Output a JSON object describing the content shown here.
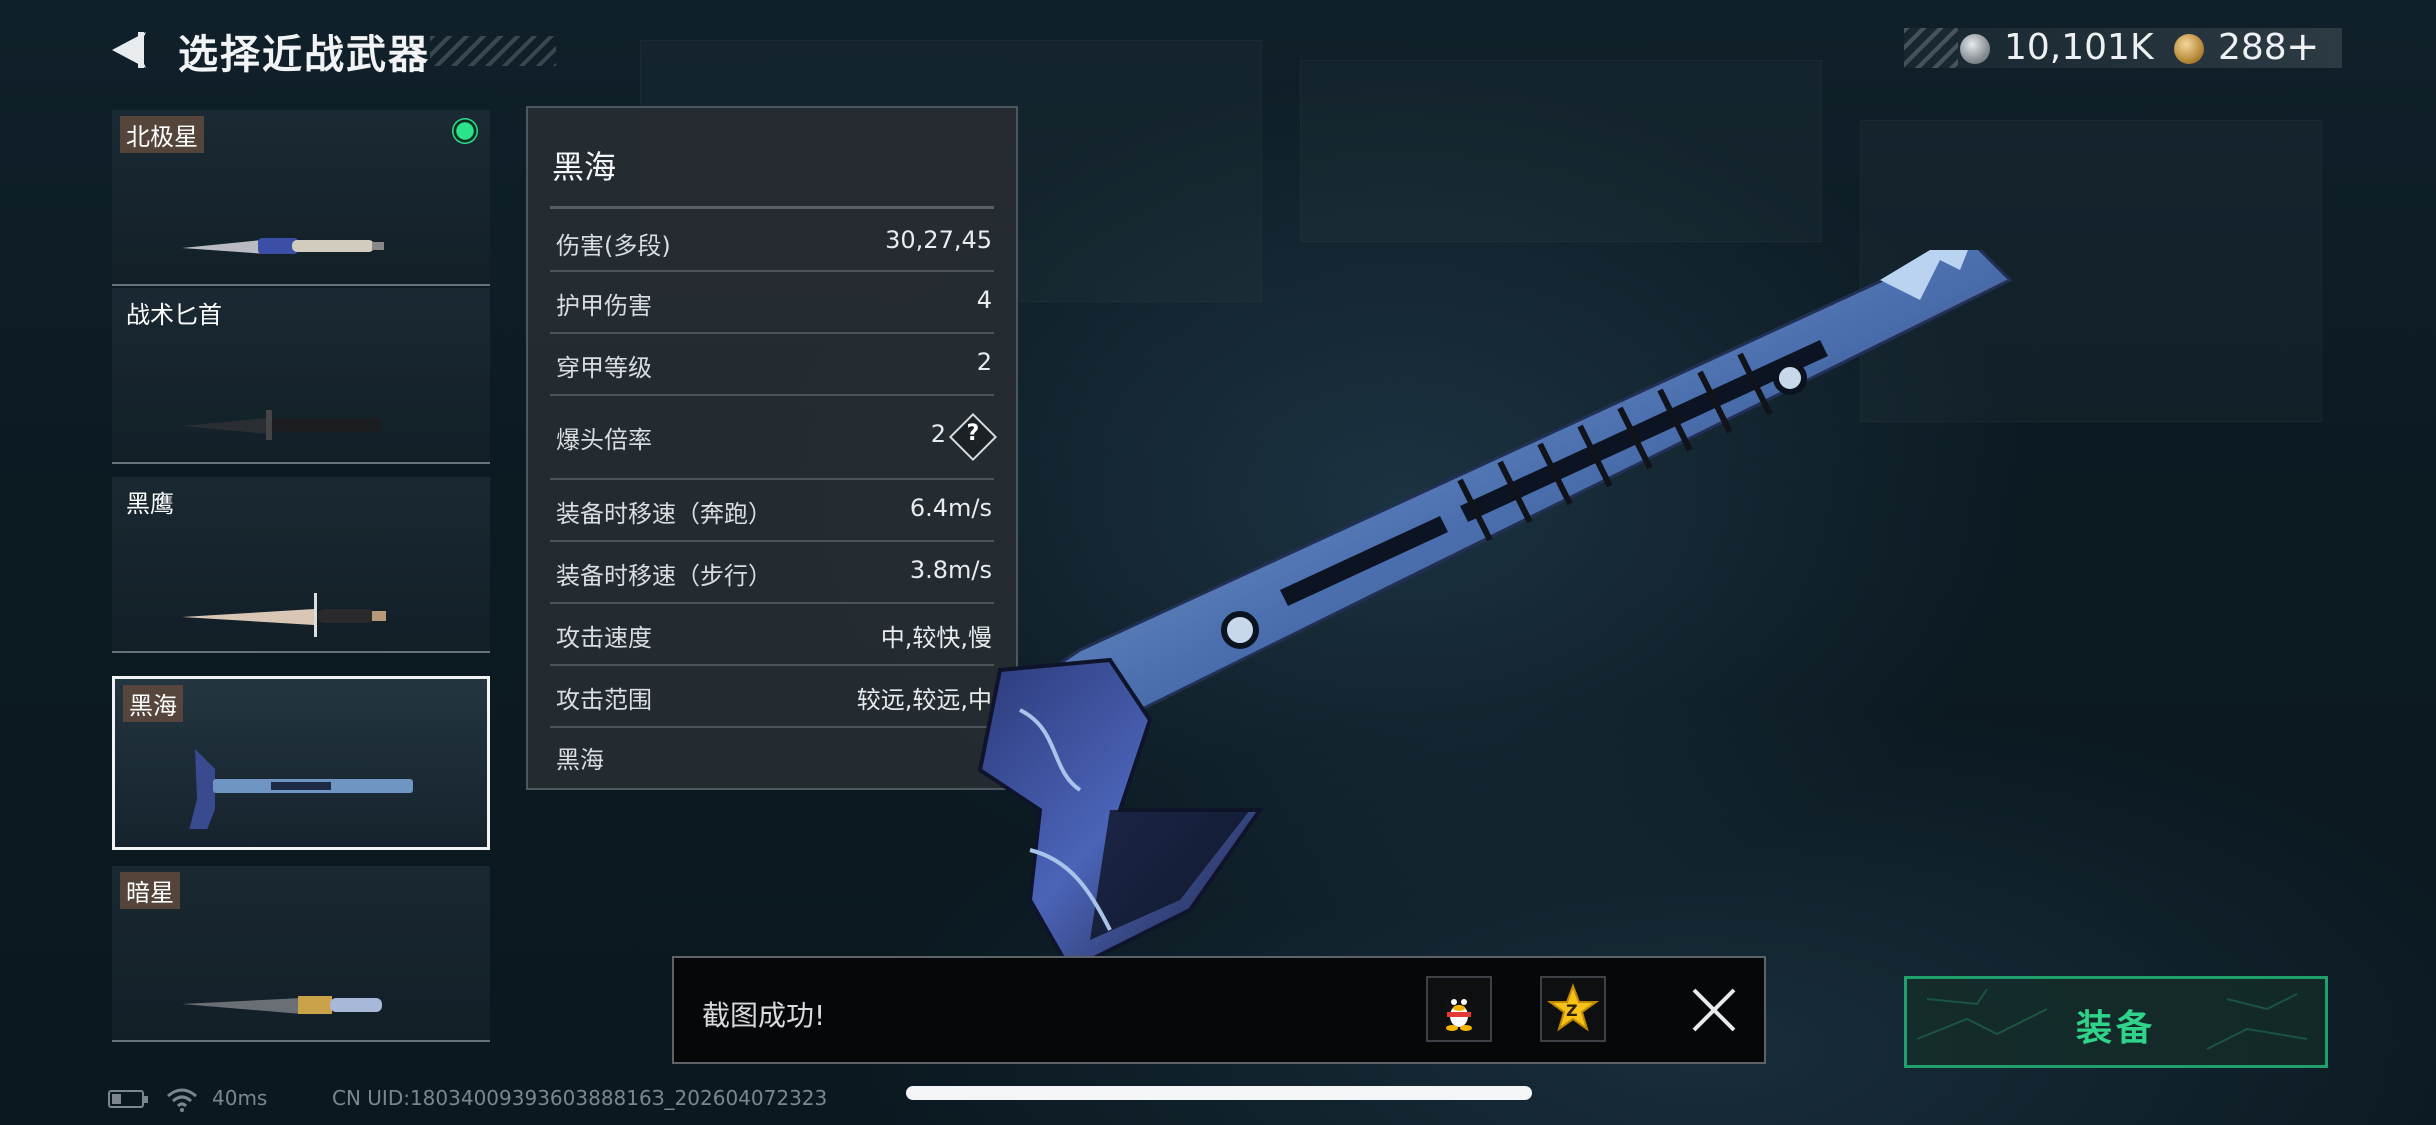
{
  "header": {
    "title": "选择近战武器"
  },
  "currency": {
    "silver": "10,101K",
    "gold": "288",
    "plus": "+"
  },
  "weapons": [
    {
      "name": "北极星",
      "equipped": true,
      "selected": false
    },
    {
      "name": "战术匕首",
      "equipped": false,
      "selected": false
    },
    {
      "name": "黑鹰",
      "equipped": false,
      "selected": false
    },
    {
      "name": "黑海",
      "equipped": false,
      "selected": true
    },
    {
      "name": "暗星",
      "equipped": false,
      "selected": false
    }
  ],
  "stats": {
    "title": "黑海",
    "rows": [
      {
        "label": "伤害(多段)",
        "value": "30,27,45"
      },
      {
        "label": "护甲伤害",
        "value": "4"
      },
      {
        "label": "穿甲等级",
        "value": "2"
      },
      {
        "label": "爆头倍率",
        "value": "2"
      },
      {
        "label": "装备时移速（奔跑）",
        "value": "6.4m/s"
      },
      {
        "label": "装备时移速（步行）",
        "value": "3.8m/s"
      },
      {
        "label": "攻击速度",
        "value": "中,较快,慢"
      },
      {
        "label": "攻击范围",
        "value": "较远,较远,中"
      }
    ],
    "help_symbol": "?",
    "footer": "黑海"
  },
  "toast": {
    "message": "截图成功!"
  },
  "equip": {
    "label": "装备"
  },
  "statusbar": {
    "ping": "40ms",
    "uid": "CN UID:1803400939360388816З_202604072323"
  },
  "colors": {
    "accent_green": "#2fd38a",
    "equipped_dot": "#2be38a",
    "panel_bg": "#262c32"
  },
  "icons": {
    "back": "chevron-left-icon",
    "silver_coin": "silver-coin-icon",
    "gold_coin": "gold-coin-icon",
    "qq": "qq-penguin-icon",
    "qzone": "qzone-star-icon",
    "close": "close-icon",
    "battery": "battery-icon",
    "wifi": "wifi-icon"
  }
}
